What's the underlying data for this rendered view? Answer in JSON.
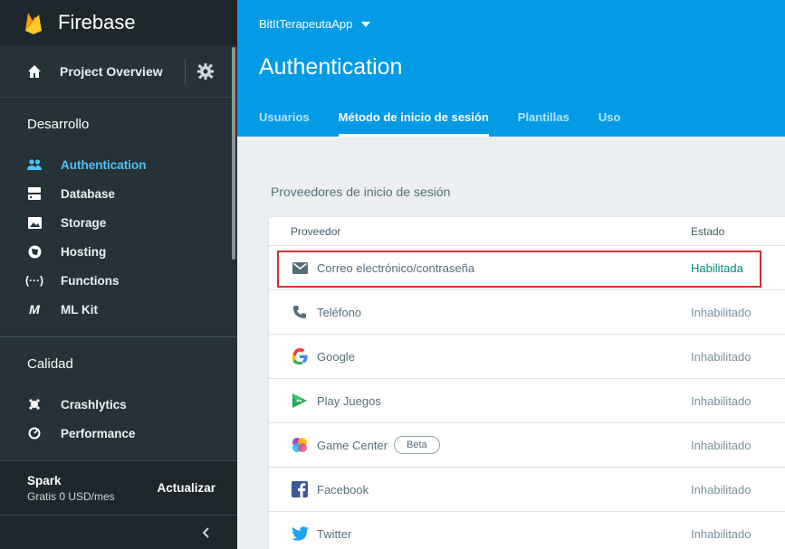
{
  "brand": "Firebase",
  "sidebar": {
    "overview_label": "Project Overview",
    "sections": [
      {
        "title": "Desarrollo",
        "items": [
          {
            "label": "Authentication",
            "icon": "people-icon",
            "active": true
          },
          {
            "label": "Database",
            "icon": "database-icon"
          },
          {
            "label": "Storage",
            "icon": "storage-icon"
          },
          {
            "label": "Hosting",
            "icon": "hosting-icon"
          },
          {
            "label": "Functions",
            "icon": "functions-icon"
          },
          {
            "label": "ML Kit",
            "icon": "mlkit-icon"
          }
        ]
      },
      {
        "title": "Calidad",
        "items": [
          {
            "label": "Crashlytics",
            "icon": "crashlytics-icon"
          },
          {
            "label": "Performance",
            "icon": "performance-icon"
          }
        ]
      }
    ],
    "plan": {
      "name": "Spark",
      "price": "Gratis 0 USD/mes",
      "upgrade": "Actualizar"
    }
  },
  "header": {
    "project": "BitItTerapeutaApp",
    "title": "Authentication",
    "tabs": [
      {
        "label": "Usuarios"
      },
      {
        "label": "Método de inicio de sesión",
        "active": true
      },
      {
        "label": "Plantillas"
      },
      {
        "label": "Uso"
      }
    ]
  },
  "main": {
    "section_title": "Proveedores de inicio de sesión",
    "columns": {
      "provider": "Proveedor",
      "status": "Estado"
    },
    "providers": [
      {
        "name": "Correo electrónico/contraseña",
        "status": "Habilitada",
        "icon": "email-icon",
        "enabled": true
      },
      {
        "name": "Teléfono",
        "status": "Inhabilitado",
        "icon": "phone-icon"
      },
      {
        "name": "Google",
        "status": "Inhabilitado",
        "icon": "google-icon"
      },
      {
        "name": "Play Juegos",
        "status": "Inhabilitado",
        "icon": "play-games-icon"
      },
      {
        "name": "Game Center",
        "status": "Inhabilitado",
        "icon": "game-center-icon",
        "badge": "Beta"
      },
      {
        "name": "Facebook",
        "status": "Inhabilitado",
        "icon": "facebook-icon"
      },
      {
        "name": "Twitter",
        "status": "Inhabilitado",
        "icon": "twitter-icon"
      }
    ]
  },
  "colors": {
    "header_blue": "#039be5",
    "sidebar_bg": "#263238",
    "active_nav": "#4fc3f7",
    "enabled_status": "#00897b",
    "highlight_border": "#d32f2f"
  }
}
